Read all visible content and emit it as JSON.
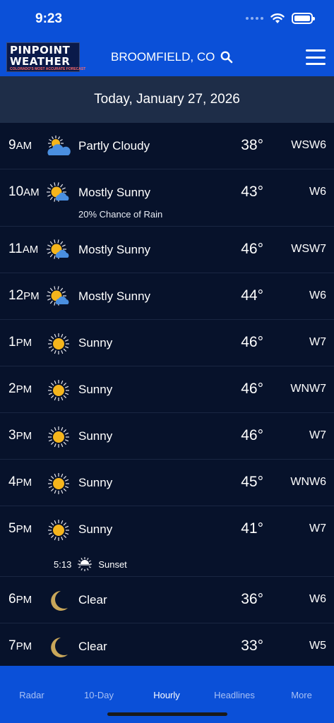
{
  "status_bar": {
    "time": "9:23"
  },
  "header": {
    "logo_line1": "PINPOINT",
    "logo_line2": "WEATHER",
    "logo_tagline": "COLORADO'S MOST ACCURATE FORECAST",
    "location": "BROOMFIELD, CO"
  },
  "date_banner": "Today, January 27, 2026",
  "hours": [
    {
      "hour": "9",
      "ampm": "AM",
      "icon": "partly-cloudy-icon",
      "condition": "Partly Cloudy",
      "temp": "38°",
      "wind": "WSW6"
    },
    {
      "hour": "10",
      "ampm": "AM",
      "icon": "mostly-sunny-icon",
      "condition": "Mostly Sunny",
      "temp": "43°",
      "wind": "W6",
      "note": "20% Chance of Rain"
    },
    {
      "hour": "11",
      "ampm": "AM",
      "icon": "mostly-sunny-icon",
      "condition": "Mostly Sunny",
      "temp": "46°",
      "wind": "WSW7"
    },
    {
      "hour": "12",
      "ampm": "PM",
      "icon": "mostly-sunny-icon",
      "condition": "Mostly Sunny",
      "temp": "44°",
      "wind": "W6"
    },
    {
      "hour": "1",
      "ampm": "PM",
      "icon": "sunny-icon",
      "condition": "Sunny",
      "temp": "46°",
      "wind": "W7"
    },
    {
      "hour": "2",
      "ampm": "PM",
      "icon": "sunny-icon",
      "condition": "Sunny",
      "temp": "46°",
      "wind": "WNW7"
    },
    {
      "hour": "3",
      "ampm": "PM",
      "icon": "sunny-icon",
      "condition": "Sunny",
      "temp": "46°",
      "wind": "W7"
    },
    {
      "hour": "4",
      "ampm": "PM",
      "icon": "sunny-icon",
      "condition": "Sunny",
      "temp": "45°",
      "wind": "WNW6"
    },
    {
      "hour": "5",
      "ampm": "PM",
      "icon": "sunny-icon",
      "condition": "Sunny",
      "temp": "41°",
      "wind": "W7",
      "sunset_time": "5:13",
      "sunset_label": "Sunset"
    },
    {
      "hour": "6",
      "ampm": "PM",
      "icon": "moon-icon",
      "condition": "Clear",
      "temp": "36°",
      "wind": "W6"
    },
    {
      "hour": "7",
      "ampm": "PM",
      "icon": "moon-icon",
      "condition": "Clear",
      "temp": "33°",
      "wind": "W5"
    }
  ],
  "tabs": [
    {
      "label": "Radar",
      "active": false
    },
    {
      "label": "10-Day",
      "active": false
    },
    {
      "label": "Hourly",
      "active": true
    },
    {
      "label": "Headlines",
      "active": false
    },
    {
      "label": "More",
      "active": false
    }
  ],
  "colors": {
    "header_blue": "#0b50d8",
    "list_bg": "#07122b",
    "sun_yellow": "#f5b51c",
    "cloud_blue": "#4a8fe0",
    "moon_gold": "#c9a75a"
  }
}
